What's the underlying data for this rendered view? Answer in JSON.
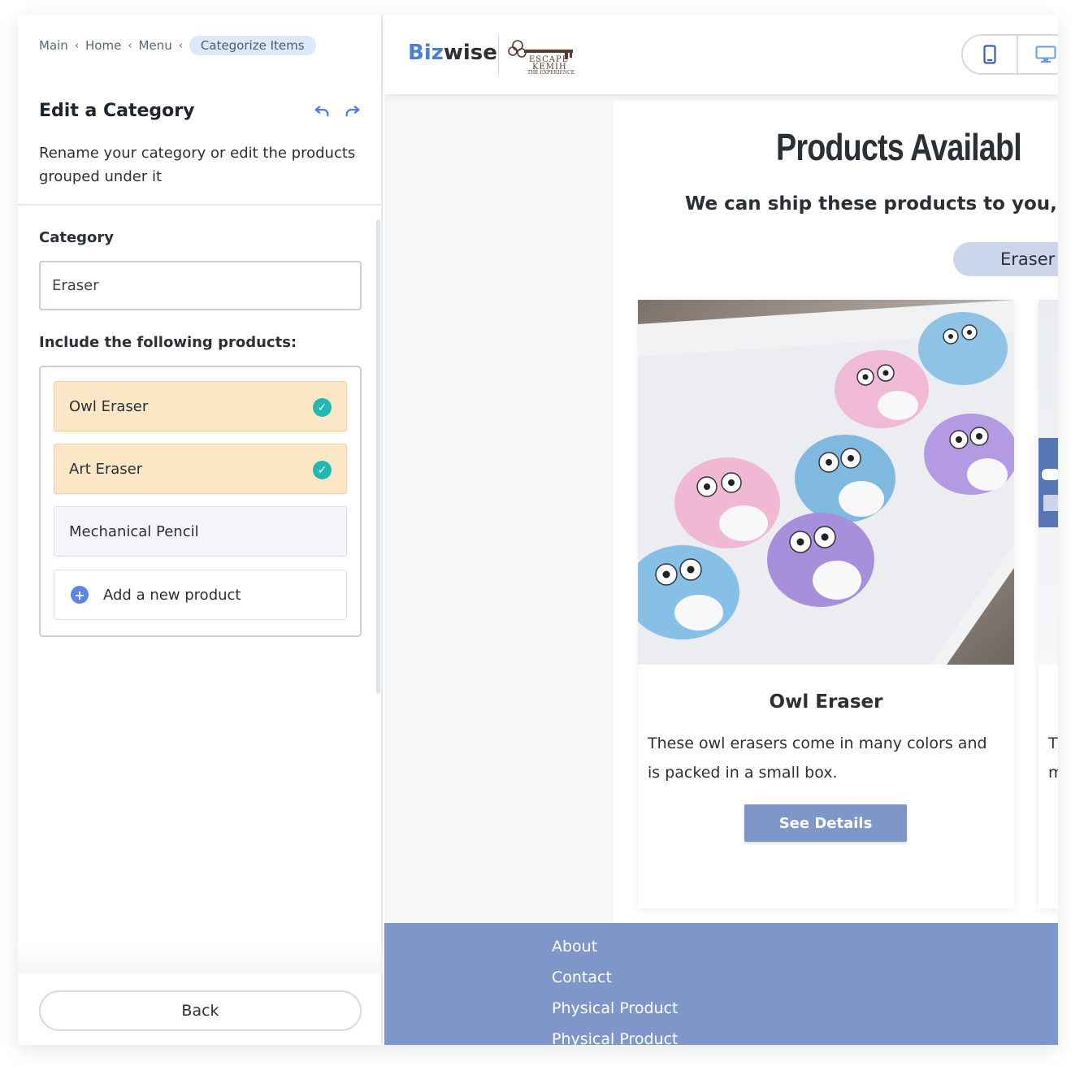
{
  "breadcrumb": {
    "items": [
      "Main",
      "Home",
      "Menu"
    ],
    "active": "Categorize Items"
  },
  "panel": {
    "title": "Edit a Category",
    "description": "Rename your category or edit the products grouped under it",
    "category_label": "Category",
    "category_value": "Eraser",
    "include_label": "Include the following products:",
    "products": [
      {
        "label": "Owl Eraser",
        "selected": true
      },
      {
        "label": "Art Eraser",
        "selected": true
      },
      {
        "label": "Mechanical Pencil",
        "selected": false
      }
    ],
    "add_product_label": "Add a new product",
    "back_label": "Back"
  },
  "preview": {
    "brand_prefix": "Biz",
    "brand_suffix": "wise",
    "heading": "Products Availabl",
    "subheading": "We can ship these products to you, no m",
    "category_pill": "Eraser",
    "card": {
      "title": "Owl Eraser",
      "description": "These owl erasers come in many colors and is packed in a small box.",
      "button": "See Details"
    },
    "card2_text_line1": "Tl",
    "card2_text_line2": "m",
    "footer_links": [
      "About",
      "Contact",
      "Physical Product",
      "Physical Product"
    ]
  },
  "colors": {
    "accent": "#4a7fd6",
    "selected_bg": "#fbe7c6",
    "check": "#23b7b3",
    "footer": "#7f96c8",
    "pill": "#ccd6ea"
  }
}
